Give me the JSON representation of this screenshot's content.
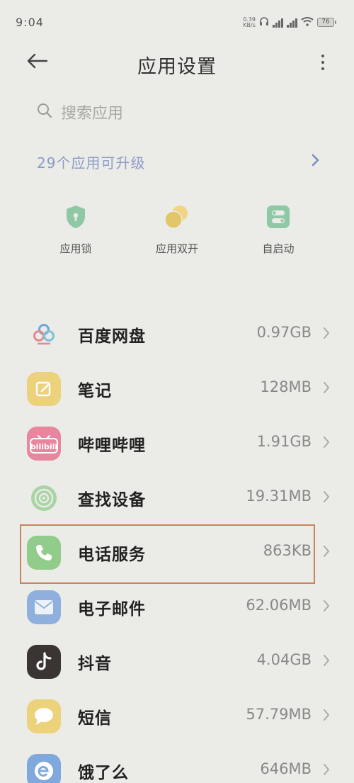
{
  "status_bar": {
    "time": "9:04",
    "net_speed_value": "0.39",
    "net_speed_unit": "KB/s",
    "battery": "76"
  },
  "header": {
    "title": "应用设置"
  },
  "search": {
    "placeholder": "搜索应用"
  },
  "upgrade": {
    "text": "29个应用可升级"
  },
  "quick_actions": [
    {
      "label": "应用锁",
      "icon": "shield-lock-icon",
      "color": "#8fc8a4"
    },
    {
      "label": "应用双开",
      "icon": "dual-circle-icon",
      "color": "#e8c86a"
    },
    {
      "label": "自启动",
      "icon": "toggle-switch-icon",
      "color": "#8fc8a4"
    }
  ],
  "apps": [
    {
      "name": "百度网盘",
      "size": "0.97GB",
      "icon": "baidu-netdisk-icon"
    },
    {
      "name": "笔记",
      "size": "128MB",
      "icon": "notes-icon",
      "color": "#ecd27a"
    },
    {
      "name": "哔哩哔哩",
      "size": "1.91GB",
      "icon": "bilibili-icon",
      "color": "#e8869e"
    },
    {
      "name": "查找设备",
      "size": "19.31MB",
      "icon": "find-device-icon",
      "color": "#a9d4a4"
    },
    {
      "name": "电话服务",
      "size": "863KB",
      "icon": "phone-icon",
      "color": "#92cc8a"
    },
    {
      "name": "电子邮件",
      "size": "62.06MB",
      "icon": "email-icon",
      "color": "#8fb0dd"
    },
    {
      "name": "抖音",
      "size": "4.04GB",
      "icon": "douyin-icon",
      "color": "#3a3533"
    },
    {
      "name": "短信",
      "size": "57.79MB",
      "icon": "message-icon",
      "color": "#ecd27a"
    },
    {
      "name": "饿了么",
      "size": "646MB",
      "icon": "eleme-icon",
      "color": "#7fa9dd"
    }
  ],
  "colors": {
    "background": "#ebebe8",
    "accent_blue": "#8d9bc6",
    "highlight_border": "#c8825c"
  }
}
